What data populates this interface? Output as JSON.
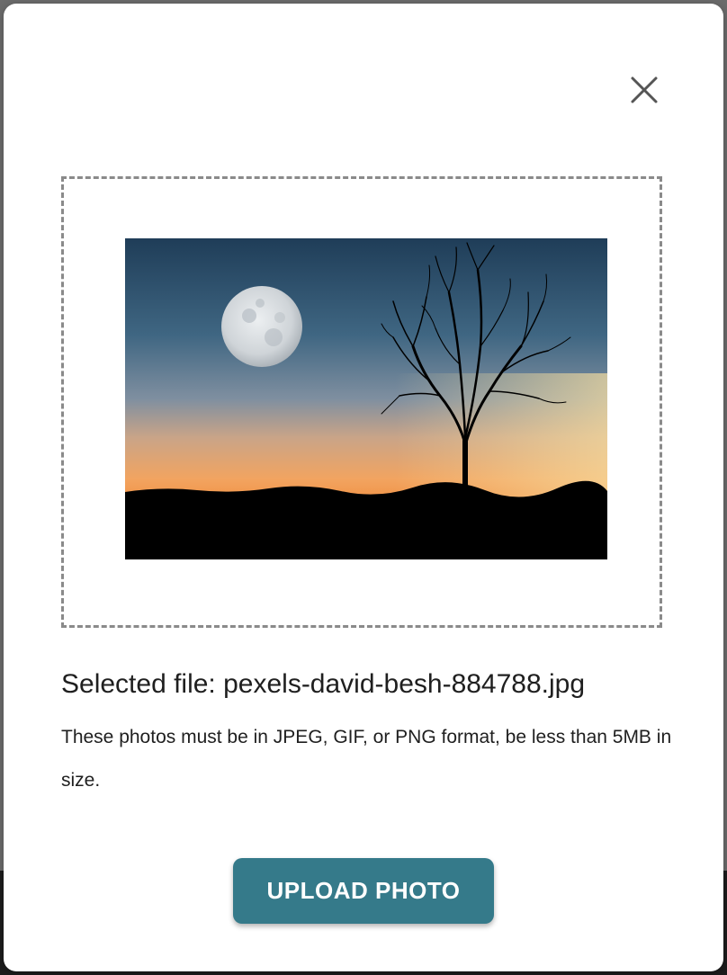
{
  "modal": {
    "close_icon": "close-icon",
    "preview_alt": "Moon and bare tree silhouette at sunset",
    "selected_file_label": "Selected file: pexels-david-besh-884788.jpg",
    "help_text": "These photos must be in JPEG, GIF, or PNG format, be less than 5MB in size.",
    "upload_button_label": "UPLOAD PHOTO"
  },
  "colors": {
    "primary_button": "#357a8a",
    "dropzone_border": "#8a8a8a",
    "text": "#1f1f1f"
  }
}
